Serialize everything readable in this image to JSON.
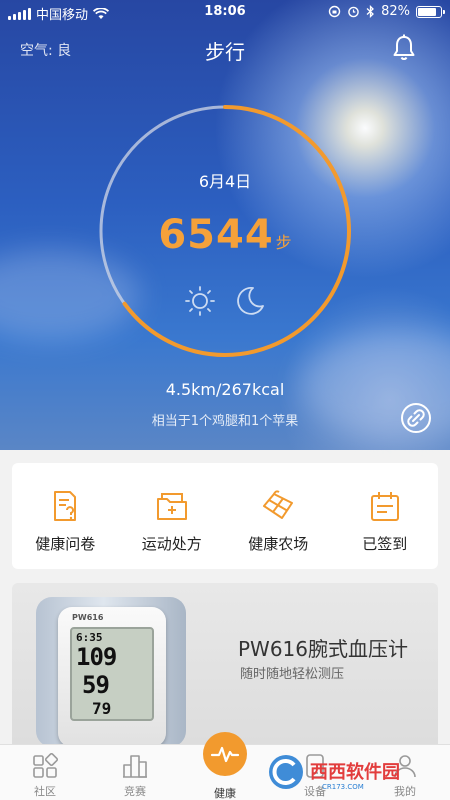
{
  "status_bar": {
    "carrier": "中国移动",
    "time": "18:06",
    "battery": "82%",
    "battery_level": 0.82
  },
  "header": {
    "air_quality": "空气: 良",
    "title": "步行",
    "bell_icon": "bell-icon"
  },
  "steps_ring": {
    "date": "6月4日",
    "steps": "6544",
    "unit": "步",
    "progress": 0.65,
    "day_icon": "sun-icon",
    "night_icon": "moon-icon"
  },
  "summary": {
    "distance_energy": "4.5km/267kcal",
    "comparison": "相当于1个鸡腿和1个苹果",
    "share_icon": "link-icon"
  },
  "shortcuts": [
    {
      "label": "健康问卷",
      "icon": "questionnaire-icon"
    },
    {
      "label": "运动处方",
      "icon": "prescription-folder-icon"
    },
    {
      "label": "健康农场",
      "icon": "farm-icon"
    },
    {
      "label": "已签到",
      "icon": "calendar-check-icon"
    }
  ],
  "promo": {
    "title": "PW616腕式血压计",
    "subtitle": "随时随地轻松测压",
    "device": {
      "brand": "PW616",
      "time": "6:35",
      "sys": "109",
      "dia": "59",
      "pulse": "79"
    }
  },
  "tabbar": [
    {
      "label": "社区",
      "icon": "community-icon",
      "active": false
    },
    {
      "label": "竞赛",
      "icon": "competition-icon",
      "active": false
    },
    {
      "label": "健康",
      "icon": "heartbeat-icon",
      "active": true
    },
    {
      "label": "设备",
      "icon": "device-icon",
      "active": false
    },
    {
      "label": "我的",
      "icon": "profile-icon",
      "active": false
    }
  ],
  "watermark": {
    "text": "西西软件园",
    "url_text": "CR173.COM"
  },
  "colors": {
    "accent": "#f29a2e",
    "sky_top": "#2747a3",
    "sky_bottom": "#5a86c6"
  }
}
